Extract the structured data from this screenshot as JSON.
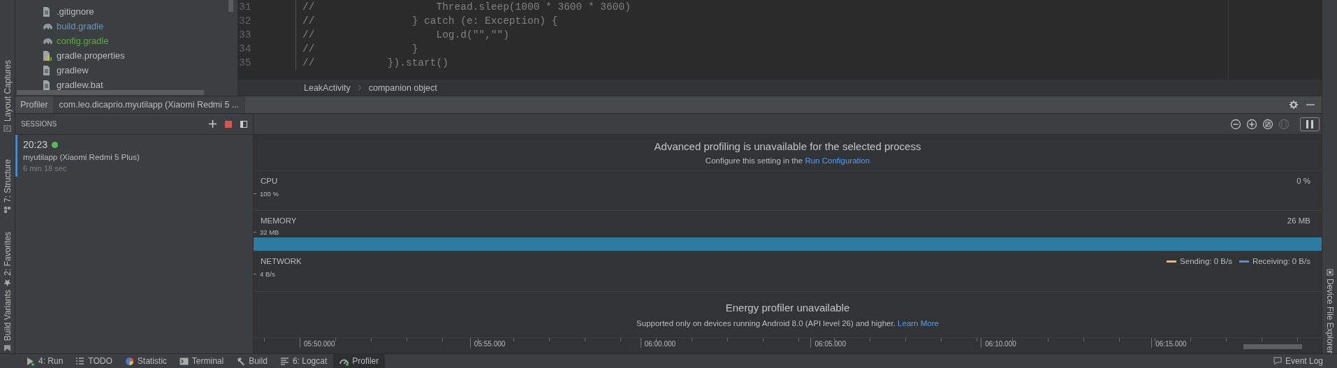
{
  "left_toolbar": [
    {
      "label": "Layout Captures",
      "kind": "captures"
    },
    {
      "label": "7: Structure",
      "kind": "structure"
    },
    {
      "label": "2: Favorites",
      "kind": "favorites"
    },
    {
      "label": "Build Variants",
      "kind": "variants"
    }
  ],
  "project_tree": [
    {
      "name": ".gitignore",
      "kind": "file",
      "color": "#bbbbbb"
    },
    {
      "name": "build.gradle",
      "kind": "gradle",
      "color": "#6897bb"
    },
    {
      "name": "config.gradle",
      "kind": "gradle",
      "color": "#62a34a"
    },
    {
      "name": "gradle.properties",
      "kind": "properties",
      "color": "#bbbbbb"
    },
    {
      "name": "gradlew",
      "kind": "file",
      "color": "#bbbbbb"
    },
    {
      "name": "gradlew.bat",
      "kind": "file",
      "color": "#bbbbbb"
    }
  ],
  "editor": {
    "lines": [
      {
        "number": "31",
        "code": "//                    Thread.sleep(1000 * 3600 * 3600)"
      },
      {
        "number": "32",
        "code": "//                } catch (e: Exception) {"
      },
      {
        "number": "33",
        "code": "//                    Log.d(\"\",\"\")"
      },
      {
        "number": "34",
        "code": "//                }"
      },
      {
        "number": "35",
        "code": "//            }).start()"
      }
    ],
    "breadcrumb": [
      "LeakActivity",
      "companion object"
    ]
  },
  "profiler": {
    "tabs": [
      {
        "label": "Profiler",
        "selected": false
      },
      {
        "label": "com.leo.dicaprio.myutilapp (Xiaomi Redmi 5 ...",
        "selected": true
      }
    ],
    "sessions_title": "SESSIONS",
    "sessions": [
      {
        "time": "20:23",
        "live": true,
        "app": "myutilapp (Xiaomi Redmi 5 Plus)",
        "duration": "6 min 18 sec",
        "selected": true
      }
    ],
    "toolbar": [
      {
        "kind": "zoom-out",
        "disabled": false
      },
      {
        "kind": "zoom-in",
        "disabled": false
      },
      {
        "kind": "reset-zoom",
        "disabled": false
      },
      {
        "kind": "attach",
        "disabled": true
      },
      {
        "kind": "pause",
        "disabled": false
      }
    ],
    "banner": {
      "title": "Advanced profiling is unavailable for the selected process",
      "text": "Configure this setting in the",
      "link": "Run Configuration"
    },
    "monitors": [
      {
        "kind": "cpu",
        "label": "CPU",
        "scale": "100 %",
        "value": "0 %"
      },
      {
        "kind": "memory",
        "label": "MEMORY",
        "scale": "32 MB",
        "value": "26 MB"
      },
      {
        "kind": "network",
        "label": "NETWORK",
        "scale": "4 B/s",
        "legend": [
          {
            "label": "Sending: 0 B/s",
            "color": "#f0b46c"
          },
          {
            "label": "Receiving: 0 B/s",
            "color": "#5b8bd6"
          }
        ]
      }
    ],
    "energy": {
      "title": "Energy profiler unavailable",
      "text": "Supported only on devices running Android 8.0 (API level 26) and higher.",
      "link": "Learn More"
    },
    "axis_labels": [
      "05:50.000",
      "05:55.000",
      "06:00.000",
      "06:05.000",
      "06:10.000",
      "06:15.000"
    ]
  },
  "right_toolbar": [
    {
      "label": "Device File Explorer"
    }
  ],
  "bottom_bar": {
    "tools": [
      {
        "label": "4: Run",
        "kind": "run",
        "selected": false
      },
      {
        "label": "TODO",
        "kind": "todo",
        "selected": false
      },
      {
        "label": "Statistic",
        "kind": "statistic",
        "selected": false
      },
      {
        "label": "Terminal",
        "kind": "terminal",
        "selected": false
      },
      {
        "label": "Build",
        "kind": "build",
        "selected": false
      },
      {
        "label": "6: Logcat",
        "kind": "logcat",
        "selected": false
      },
      {
        "label": "Profiler",
        "kind": "profiler",
        "selected": true
      }
    ],
    "event_log": "Event Log"
  }
}
